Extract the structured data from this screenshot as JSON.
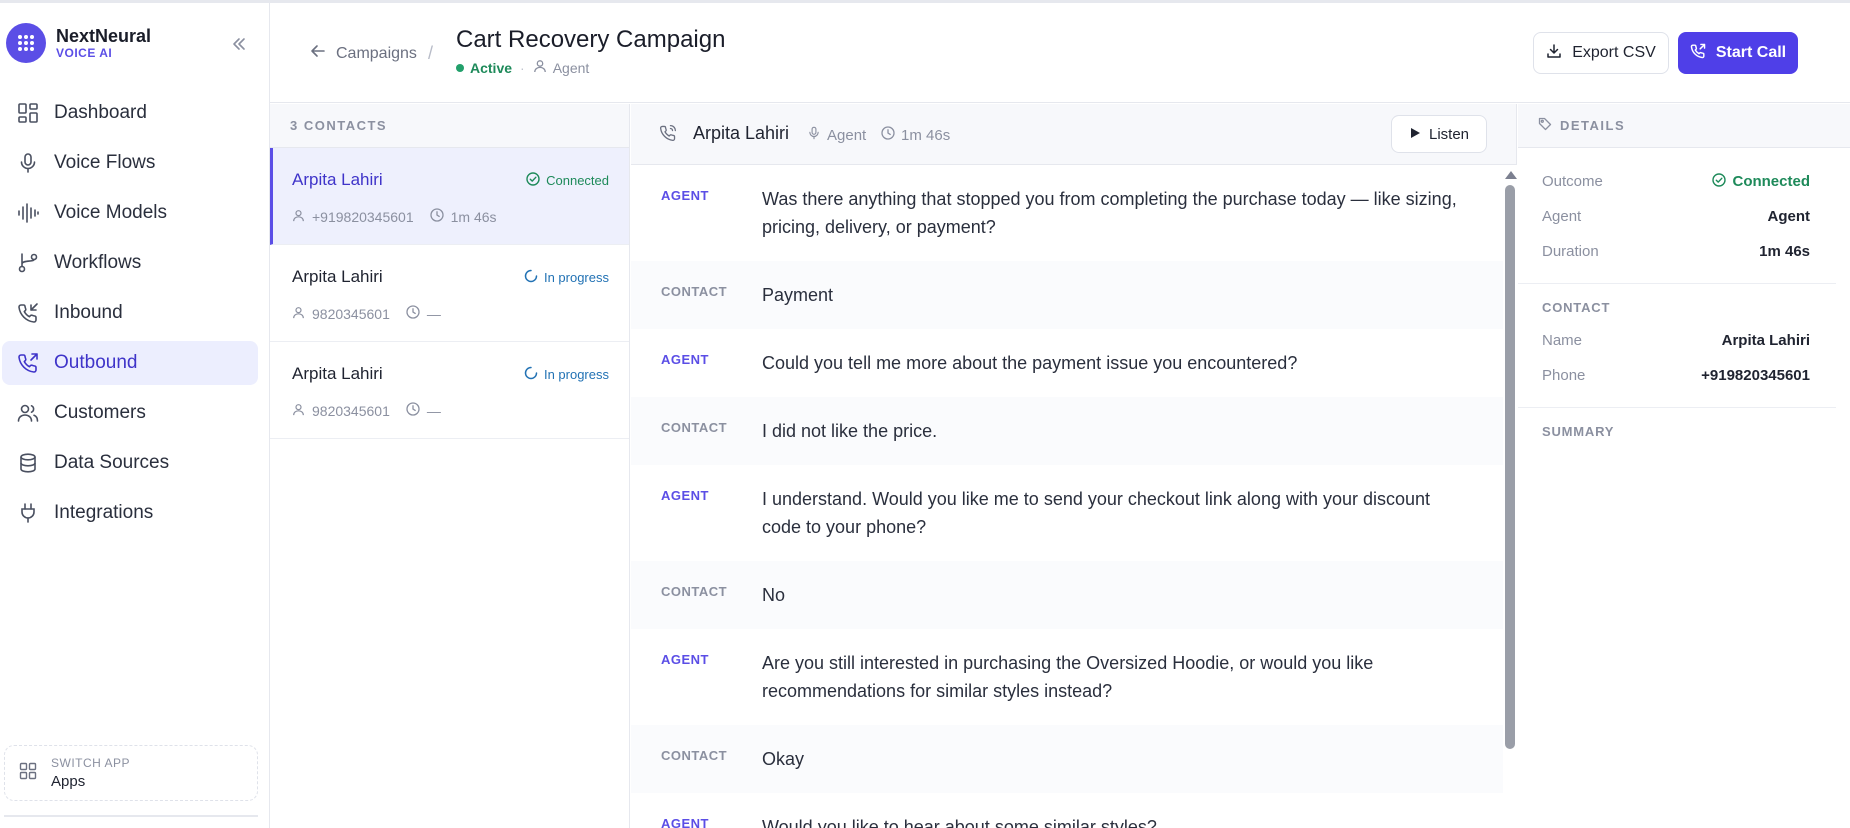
{
  "brand": {
    "name": "NextNeural",
    "sub": "VOICE AI"
  },
  "sidebar": {
    "items": [
      {
        "label": "Dashboard",
        "icon": "dashboard-icon"
      },
      {
        "label": "Voice Flows",
        "icon": "microphone-icon"
      },
      {
        "label": "Voice Models",
        "icon": "waveform-icon"
      },
      {
        "label": "Workflows",
        "icon": "workflow-icon"
      },
      {
        "label": "Inbound",
        "icon": "phone-incoming-icon"
      },
      {
        "label": "Outbound",
        "icon": "phone-outgoing-icon"
      },
      {
        "label": "Customers",
        "icon": "users-icon"
      },
      {
        "label": "Data Sources",
        "icon": "database-icon"
      },
      {
        "label": "Integrations",
        "icon": "plug-icon"
      }
    ],
    "active": "Outbound",
    "switch_app": {
      "label": "SWITCH APP",
      "value": "Apps"
    }
  },
  "header": {
    "back_label": "Campaigns",
    "separator": "/",
    "title": "Cart Recovery Campaign",
    "status": "Active",
    "status_sep": "·",
    "agent": "Agent",
    "export_label": "Export CSV",
    "call_label": "Start Call"
  },
  "contacts": {
    "heading": "3 CONTACTS",
    "list": [
      {
        "name": "Arpita Lahiri",
        "status": "Connected",
        "phone": "+919820345601",
        "duration": "1m 46s"
      },
      {
        "name": "Arpita Lahiri",
        "status": "In progress",
        "phone": "9820345601",
        "duration": "—"
      },
      {
        "name": "Arpita Lahiri",
        "status": "In progress",
        "phone": "9820345601",
        "duration": "—"
      }
    ]
  },
  "transcript": {
    "name": "Arpita Lahiri",
    "agent": "Agent",
    "duration": "1m 46s",
    "listen_label": "Listen",
    "messages": [
      {
        "role": "AGENT",
        "text": "Was there anything that stopped you from completing the purchase today — like sizing, pricing, delivery, or payment?"
      },
      {
        "role": "CONTACT",
        "text": "Payment"
      },
      {
        "role": "AGENT",
        "text": "Could you tell me more about the payment issue you encountered?"
      },
      {
        "role": "CONTACT",
        "text": "I did not like the price."
      },
      {
        "role": "AGENT",
        "text": "I understand. Would you like me to send your checkout link along with your discount code to your phone?"
      },
      {
        "role": "CONTACT",
        "text": "No"
      },
      {
        "role": "AGENT",
        "text": "Are you still interested in purchasing the Oversized Hoodie, or would you like recommendations for similar styles instead?"
      },
      {
        "role": "CONTACT",
        "text": "Okay"
      },
      {
        "role": "AGENT",
        "text": "Would you like to hear about some similar styles?"
      }
    ]
  },
  "details": {
    "heading": "DETAILS",
    "outcome": {
      "label": "Outcome",
      "value": "Connected"
    },
    "agent": {
      "label": "Agent",
      "value": "Agent"
    },
    "duration": {
      "label": "Duration",
      "value": "1m 46s"
    },
    "contact_title": "CONTACT",
    "name": {
      "label": "Name",
      "value": "Arpita Lahiri"
    },
    "phone": {
      "label": "Phone",
      "value": "+919820345601"
    },
    "summary_title": "SUMMARY"
  },
  "colors": {
    "accent": "#4f3fe8",
    "success": "#1e8a5a",
    "progress": "#2272b4"
  }
}
